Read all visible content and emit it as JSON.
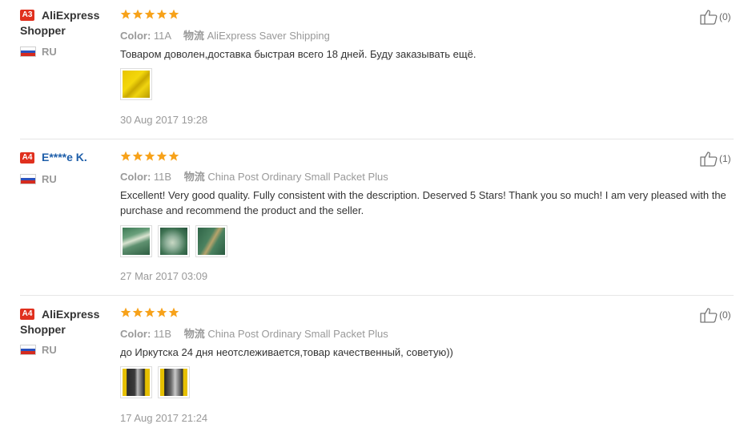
{
  "reviews": [
    {
      "badge": "A3",
      "name_line1": "AliExpress",
      "name_line2": "Shopper",
      "country": "RU",
      "color_label": "Color:",
      "color_value": "11A",
      "logistics_label": "物流",
      "logistics_value": "AliExpress Saver Shipping",
      "text": "Товаром доволен,доставка быстрая всего 18 дней. Буду заказывать ещё.",
      "date": "30 Aug 2017 19:28",
      "helpful": "(0)",
      "stars": 5
    },
    {
      "badge": "A4",
      "name_line1": "E****e K.",
      "country": "RU",
      "color_label": "Color:",
      "color_value": "11B",
      "logistics_label": "物流",
      "logistics_value": "China Post Ordinary Small Packet Plus",
      "text": "Excellent! Very good quality. Fully consistent with the description. Deserved 5 Stars! Thank you so much! I am very pleased with the purchase and recommend the product and the seller.",
      "date": "27 Mar 2017 03:09",
      "helpful": "(1)",
      "stars": 5
    },
    {
      "badge": "A4",
      "name_line1": "AliExpress",
      "name_line2": "Shopper",
      "country": "RU",
      "color_label": "Color:",
      "color_value": "11B",
      "logistics_label": "物流",
      "logistics_value": "China Post Ordinary Small Packet Plus",
      "text": "до Иркутска 24 дня неотслеживается,товар качественный, советую))",
      "date": "17 Aug 2017 21:24",
      "helpful": "(0)",
      "stars": 5
    }
  ],
  "colors": {
    "star": "#f7a21a",
    "badge": "#e0301e",
    "link_name": "#1f5faa"
  },
  "icons": {
    "rating": "star-icon",
    "helpful": "thumbs-up-icon",
    "flag": "russia-flag-icon"
  }
}
